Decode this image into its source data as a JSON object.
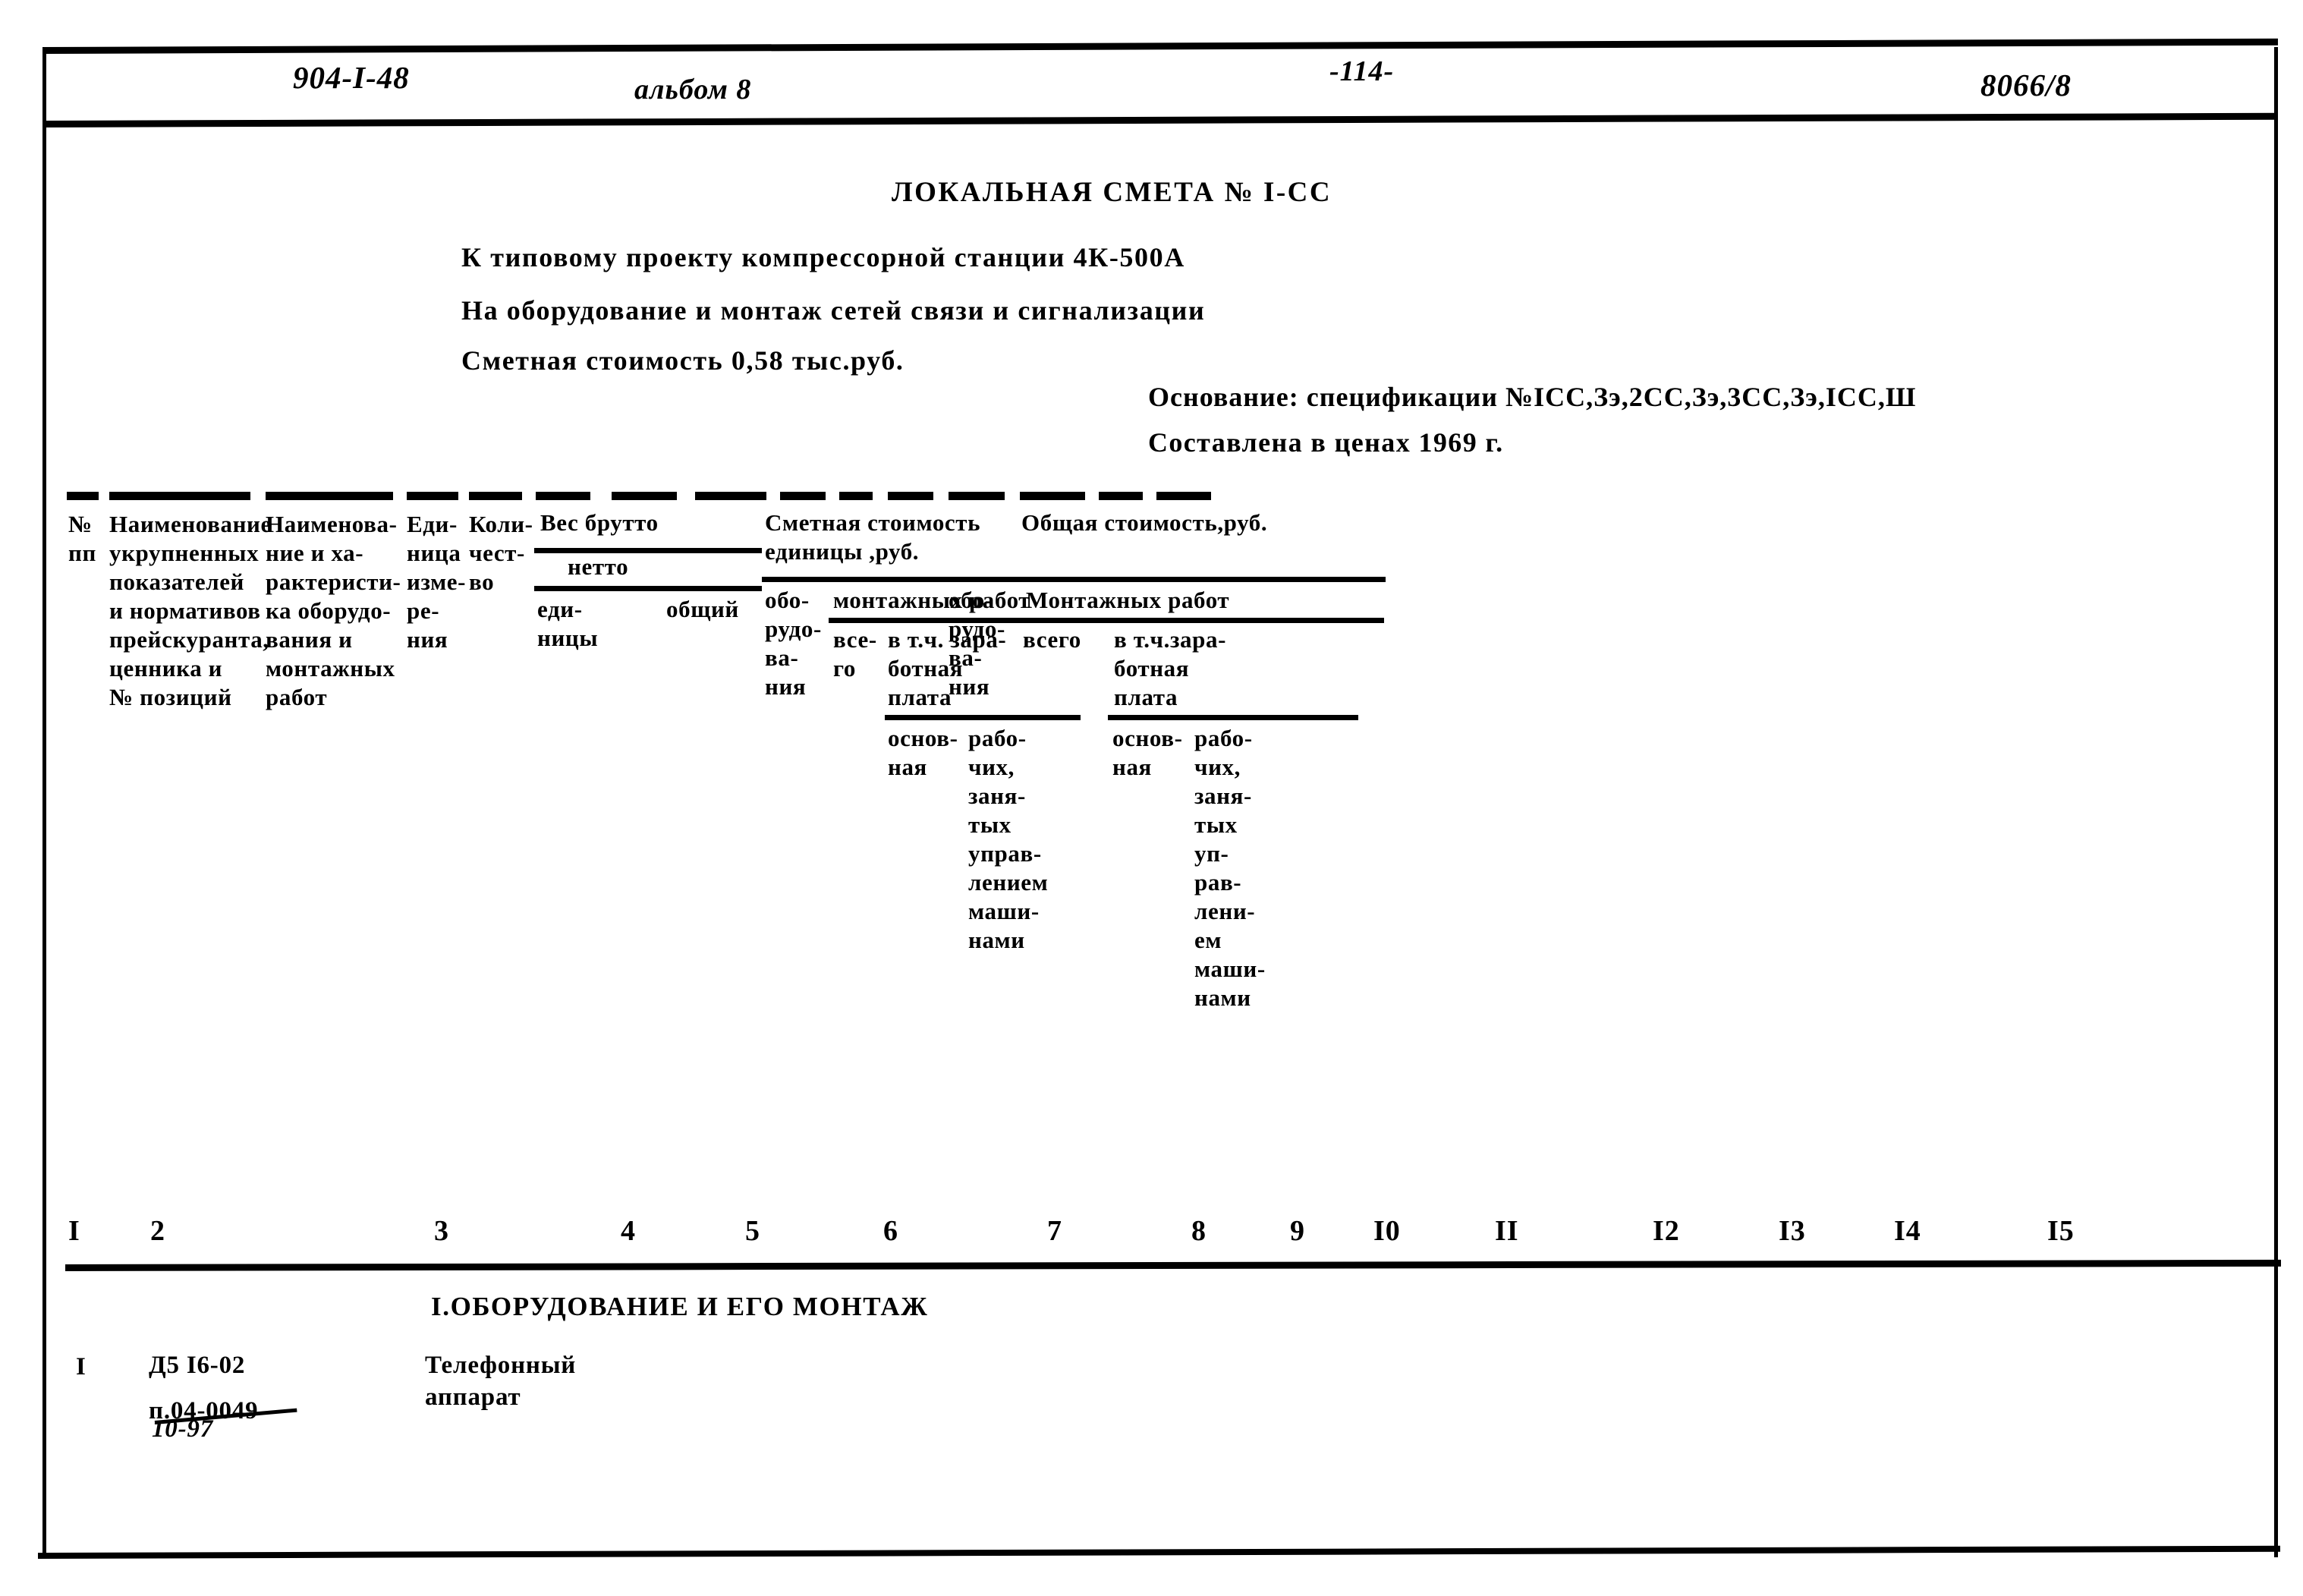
{
  "banner": {
    "project_code": "904-I-48",
    "album": "альбом 8",
    "page_number": "-114-",
    "sheet_code": "8066/8"
  },
  "title_block": {
    "doc_title": "ЛОКАЛЬНАЯ СМЕТА № I-СС",
    "line_project": "К типовому  проекту компрессорной  станции   4К-500А",
    "line_scope": "На оборудование и  монтаж сетей связи  и   сигнализации",
    "line_cost": "Сметная стоимость 0,58 тыс.руб.",
    "basis_line1": "Основание: спецификации №IСС,Зэ,2СС,Зэ,3СС,Зэ,IСС,Ш",
    "basis_line2": "Составлена в ценах 1969 г."
  },
  "table": {
    "headers": {
      "col1": "№\nпп",
      "col2": "Наименование\nукрупненных\nпоказателей\nи нормативов\nпрейскуранта,\nценника  и\n№  позиций",
      "col3": "Наименова-\nние  и  ха-\nрактеристи-\nка  оборудо-\nвания и\nмонтажных\n   работ",
      "col4": "Еди-\nница\nизме-\nре-\nния",
      "col5": "Коли-\nчест-\nво",
      "group_weight": "Вес брутто",
      "group_weight_sub": "нетто",
      "col6": "еди-\nницы",
      "col7": "общий",
      "group_unit_cost": "Сметная стоимость\nединицы ,руб.",
      "col8": "обо-\nрудо-\nва-\nния",
      "group_unit_install": "монтажных работ",
      "col9": "все-\nго",
      "group_unit_wage": "в т.ч. зара-\nботная\nплата",
      "col10": "основ-\nная",
      "col11": "рабо-\nчих,\nзаня-\nтых\nуправ-\nлением\nмаши-\nнами",
      "group_total_cost": "Общая стоимость,руб.",
      "col12": "обо-\nрудо-\nва-\nния",
      "group_total_install": "Монтажных работ",
      "col13": "всего",
      "group_total_wage": "в т.ч.зара-\nботная\nплата",
      "col14": "основ-\nная",
      "col15": "рабо-\nчих,\nзаня-\nтых\nуп-\nрав-\nлени-\nем\nмаши-\nнами"
    },
    "column_numbers": [
      "I",
      "2",
      "3",
      "4",
      "5",
      "6",
      "7",
      "8",
      "9",
      "I0",
      "II",
      "I2",
      "I3",
      "I4",
      "I5"
    ],
    "section_heading": "I.ОБОРУДОВАНИЕ И ЕГО МОНТАЖ",
    "rows": [
      {
        "num": "I",
        "code_line1": "Д5 I6-02",
        "code_line2": "п.04-0049",
        "code_overstrike": "10-97",
        "name": "Телефонный\nаппарат",
        "unit": "",
        "qty": "",
        "weight_unit": "",
        "weight_total": "",
        "unit_equip": "",
        "unit_install_all": "",
        "unit_wage_main": "",
        "unit_wage_mach": "",
        "total_equip": "",
        "total_install_all": "",
        "total_wage_main": "",
        "total_wage_mach": ""
      }
    ]
  }
}
